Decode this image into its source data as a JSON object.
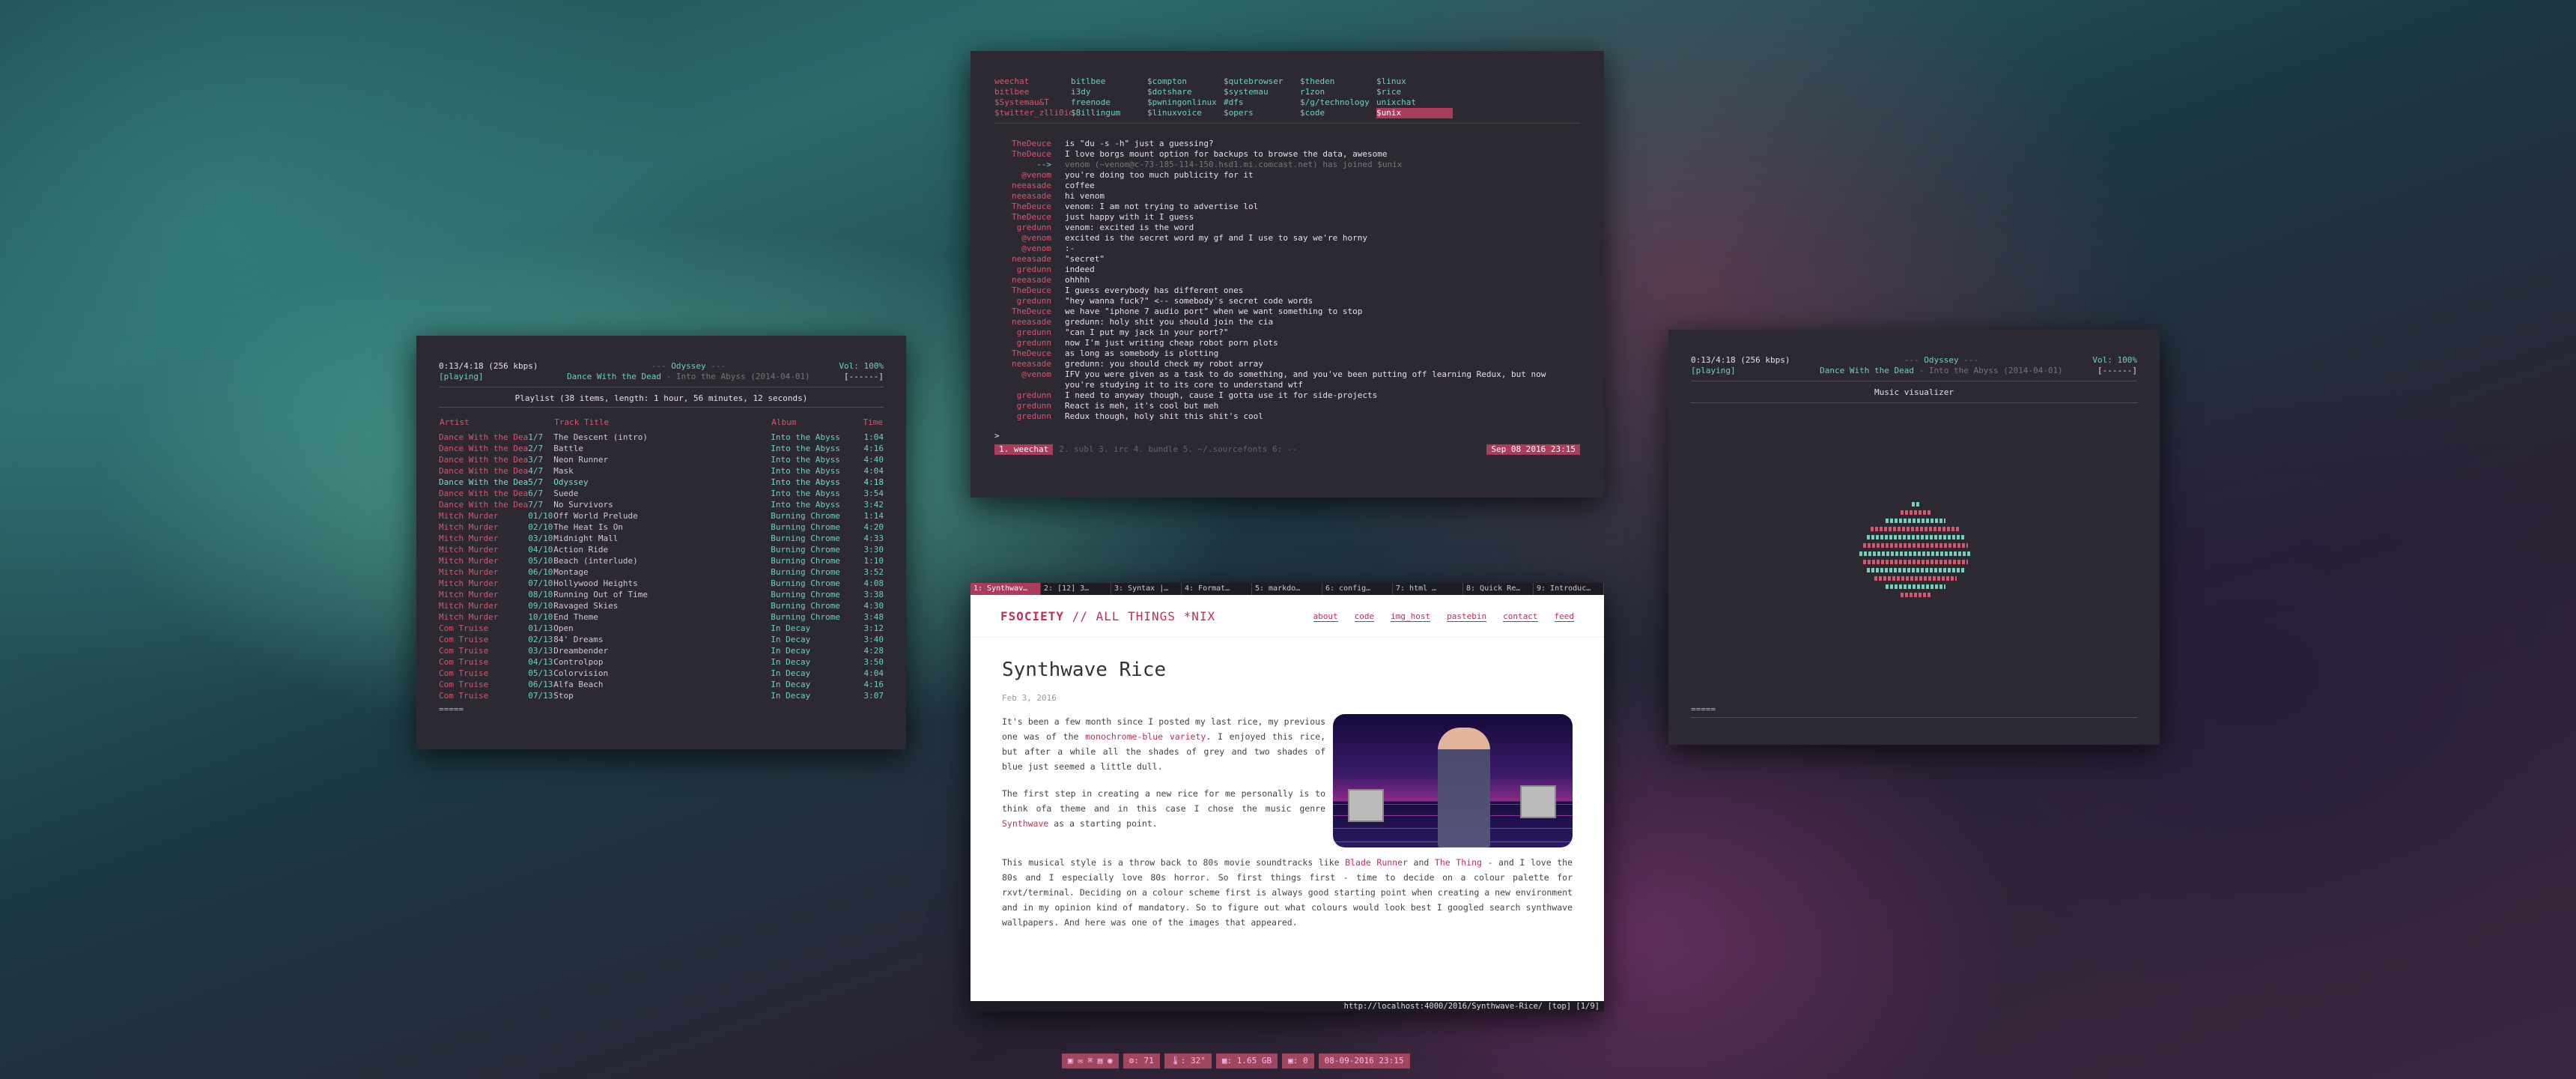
{
  "ncmpcpp": {
    "elapsed": "0:13/4:18 (256 kbps)",
    "state": "[playing]",
    "song_title": "Odyssey",
    "song_sub_artist": "Dance With the Dead",
    "song_sub_album": "Into the Abyss (2014-04-01)",
    "volume": "Vol: 100%",
    "flags": "[------]",
    "playlist_header": "Playlist (38 items, length: 1 hour, 56 minutes, 12 seconds)",
    "columns": [
      "Artist",
      "Track Title",
      "Album",
      "Time"
    ],
    "rows": [
      [
        "Dance With the Dea",
        "1/7",
        "The Descent (intro)",
        "Into the Abyss",
        "1:04"
      ],
      [
        "Dance With the Dea",
        "2/7",
        "Battle",
        "Into the Abyss",
        "4:16"
      ],
      [
        "Dance With the Dea",
        "3/7",
        "Neon Runner",
        "Into the Abyss",
        "4:40"
      ],
      [
        "Dance With the Dea",
        "4/7",
        "Mask",
        "Into the Abyss",
        "4:04"
      ],
      [
        "Dance With the Dea",
        "5/7",
        "Odyssey",
        "Into the Abyss",
        "4:18"
      ],
      [
        "Dance With the Dea",
        "6/7",
        "Suede",
        "Into the Abyss",
        "3:54"
      ],
      [
        "Dance With the Dea",
        "7/7",
        "No Survivors",
        "Into the Abyss",
        "3:42"
      ],
      [
        "Mitch Murder",
        "01/10",
        "Off World Prelude",
        "Burning Chrome",
        "1:14"
      ],
      [
        "Mitch Murder",
        "02/10",
        "The Heat Is On",
        "Burning Chrome",
        "4:20"
      ],
      [
        "Mitch Murder",
        "03/10",
        "Midnight Mall",
        "Burning Chrome",
        "4:33"
      ],
      [
        "Mitch Murder",
        "04/10",
        "Action Ride",
        "Burning Chrome",
        "3:30"
      ],
      [
        "Mitch Murder",
        "05/10",
        "Beach (interlude)",
        "Burning Chrome",
        "1:10"
      ],
      [
        "Mitch Murder",
        "06/10",
        "Montage",
        "Burning Chrome",
        "3:52"
      ],
      [
        "Mitch Murder",
        "07/10",
        "Hollywood Heights",
        "Burning Chrome",
        "4:08"
      ],
      [
        "Mitch Murder",
        "08/10",
        "Running Out of Time",
        "Burning Chrome",
        "3:38"
      ],
      [
        "Mitch Murder",
        "09/10",
        "Ravaged Skies",
        "Burning Chrome",
        "4:30"
      ],
      [
        "Mitch Murder",
        "10/10",
        "End Theme",
        "Burning Chrome",
        "3:48"
      ],
      [
        "Com Truise",
        "01/13",
        "Open",
        "In Decay",
        "3:12"
      ],
      [
        "Com Truise",
        "02/13",
        "84' Dreams",
        "In Decay",
        "3:40"
      ],
      [
        "Com Truise",
        "03/13",
        "Dreambender",
        "In Decay",
        "4:28"
      ],
      [
        "Com Truise",
        "04/13",
        "Controlpop",
        "In Decay",
        "3:50"
      ],
      [
        "Com Truise",
        "05/13",
        "Colorvision",
        "In Decay",
        "4:04"
      ],
      [
        "Com Truise",
        "06/13",
        "Alfa Beach",
        "In Decay",
        "4:16"
      ],
      [
        "Com Truise",
        "07/13",
        "Stop",
        "In Decay",
        "3:07"
      ]
    ],
    "playing_index": 4,
    "progress_bar": "====="
  },
  "weechat": {
    "buffers": [
      "weechat",
      "bitlbee",
      "$compton",
      "$qutebrowser",
      "$theden",
      "$linux",
      "bitlbee",
      "i3dy",
      "$dotshare",
      "$systemau",
      "r1zon",
      "$rice",
      "$Systemau&T",
      "freenode",
      "$pwningonlinux",
      "#dfs",
      "$/g/technology",
      "unixchat",
      "$twitter_zlli0id",
      "$8illingum",
      "$linuxvoice",
      "$opers",
      "$code",
      "$unix"
    ],
    "active_buffer_index": 23,
    "lines": [
      [
        "TheDeuce",
        "is \"du -s -h\" just a guessing?"
      ],
      [
        "TheDeuce",
        "I love borgs mount option for backups to browse the data, awesome"
      ],
      [
        "-->",
        "venom (~venom@c-73-185-114-150.hsd1.mi.comcast.net) has joined $unix"
      ],
      [
        "@venom",
        "you're doing too much publicity for it"
      ],
      [
        "neeasade",
        "coffee"
      ],
      [
        "neeasade",
        "hi venom"
      ],
      [
        "TheDeuce",
        "venom: I am not trying to advertise lol"
      ],
      [
        "TheDeuce",
        "just happy with it I guess"
      ],
      [
        "gredunn",
        "venom: excited is the word"
      ],
      [
        "@venom",
        "excited is the secret word my gf and I use to say we're horny"
      ],
      [
        "@venom",
        ":-"
      ],
      [
        "neeasade",
        "\"secret\""
      ],
      [
        "gredunn",
        "indeed"
      ],
      [
        "neeasade",
        "ohhhh"
      ],
      [
        "TheDeuce",
        "I guess everybody has different ones"
      ],
      [
        "gredunn",
        "\"hey wanna fuck?\" <-- somebody's secret code words"
      ],
      [
        "TheDeuce",
        "we have \"iphone 7 audio port\" when we want something to stop"
      ],
      [
        "neeasade",
        "gredunn: holy shit you should join the cia"
      ],
      [
        "gredunn",
        "\"can I put my jack in your port?\""
      ],
      [
        "gredunn",
        "now I'm just writing cheap robot porn plots"
      ],
      [
        "TheDeuce",
        "as long as somebody is plotting"
      ],
      [
        "neeasade",
        "gredunn: you should check my robot array"
      ],
      [
        "@venom",
        "IFV you were given as a task to do something, and you've been putting off learning Redux, but now you're studying it to its core to understand wtf"
      ],
      [
        "gredunn",
        "I need to anyway though, cause I gotta use it for side-projects"
      ],
      [
        "gredunn",
        "React is meh, it's cool but meh"
      ],
      [
        "gredunn",
        "Redux though, holy shit this shit's cool"
      ]
    ],
    "prompt": ">",
    "status_active": "1. weechat",
    "status_others": "2. subl   3. irc   4. bundle   5. ~/.sourcefonts   6: --",
    "status_time": "Sep 08 2016  23:15"
  },
  "visualizer": {
    "elapsed": "0:13/4:18 (256 kbps)",
    "state": "[playing]",
    "song_title": "Odyssey",
    "song_sub_artist": "Dance With the Dead",
    "song_sub_album": "Into the Abyss (2014-04-01)",
    "volume": "Vol: 100%",
    "flags": "[------]",
    "panel_title": "Music visualizer",
    "progress_bar": "====="
  },
  "qutebrowser": {
    "tabs": [
      "1: Synthwav…",
      "2: [12] 3…",
      "3: Syntax |…",
      "4: Format…",
      "5: markdo…",
      "6: config…",
      "7: html …",
      "8: Quick Re…",
      "9: Introduc…"
    ],
    "site_brand": "FSOCIETY",
    "site_brand_sep": "//",
    "site_brand_rest": "ALL THINGS *NIX",
    "nav": [
      "about",
      "code",
      "img_host",
      "pastebin",
      "contact",
      "feed"
    ],
    "title": "Synthwave Rice",
    "date": "Feb 3, 2016",
    "p1_a": "It's been a few month since I posted my last rice, my previous one was of the ",
    "p1_link": "monochrome-blue variety",
    "p1_b": ". I enjoyed this rice, but after a while all the shades of grey and two shades of blue just seemed a little dull.",
    "p2_a": "The first step in creating a new rice for me personally is to think ofa theme and in this case I chose the music genre ",
    "p2_link": "Synthwave",
    "p2_b": " as a starting point.",
    "p3_a": "This musical style is a throw back to 80s movie soundtracks like ",
    "p3_link1": "Blade Runner",
    "p3_mid": " and ",
    "p3_link2": "The Thing",
    "p3_b": " - and I love the 80s and I especially love 80s horror. So first things first - time to decide on a colour palette for rxvt/terminal. Deciding on a colour scheme first is always good starting point when creating a new environment and in my opinion kind of mandatory. So to figure out what colours would look best I googled search synthwave wallpapers. And here was one of the images that appeared.",
    "status_url": "http://localhost:4000/2016/Synthwave-Rice/ [top] [1/9]"
  },
  "bar": {
    "cpu": "71",
    "temp": "32°",
    "mem": "1.65 GB",
    "updates": "0",
    "datetime": "08-09-2016 23:15"
  },
  "colors": {
    "accent": "#d9566f",
    "teal": "#6fd0bb",
    "panel": "#2c2933",
    "bar": "#a0465f"
  }
}
